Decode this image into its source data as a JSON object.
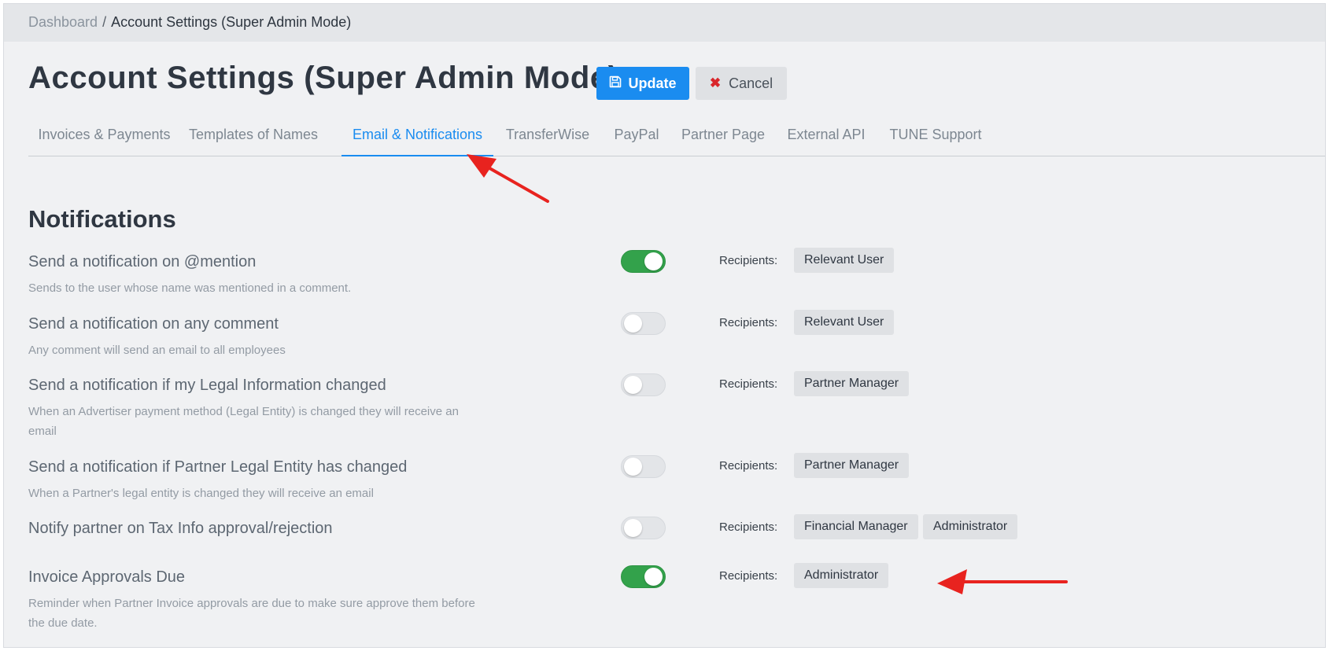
{
  "breadcrumb": {
    "home": "Dashboard",
    "separator": "/",
    "current": "Account Settings (Super Admin Mode)"
  },
  "header": {
    "title": "Account Settings (Super Admin Mode)",
    "update_label": "Update",
    "cancel_label": "Cancel"
  },
  "tabs": [
    {
      "label": "Invoices & Payments",
      "active": false
    },
    {
      "label": "Templates of Names",
      "active": false
    },
    {
      "label": "Email & Notifications",
      "active": true
    },
    {
      "label": "TransferWise",
      "active": false
    },
    {
      "label": "PayPal",
      "active": false
    },
    {
      "label": "Partner Page",
      "active": false
    },
    {
      "label": "External API",
      "active": false
    },
    {
      "label": "TUNE Support",
      "active": false
    }
  ],
  "section": {
    "title": "Notifications",
    "recipients_label": "Recipients:"
  },
  "notifications": [
    {
      "title": "Send a notification on @mention",
      "description": "Sends to the user whose name was mentioned in a comment.",
      "enabled": true,
      "recipients": [
        "Relevant User"
      ]
    },
    {
      "title": "Send a notification on any comment",
      "description": "Any comment will send an email to all employees",
      "enabled": false,
      "recipients": [
        "Relevant User"
      ]
    },
    {
      "title": "Send a notification if my Legal Information changed",
      "description": "When an Advertiser payment method (Legal Entity) is changed they will receive an email",
      "enabled": false,
      "recipients": [
        "Partner Manager"
      ]
    },
    {
      "title": "Send a notification if Partner Legal Entity has changed",
      "description": "When a Partner's legal entity is changed they will receive an email",
      "enabled": false,
      "recipients": [
        "Partner Manager"
      ]
    },
    {
      "title": "Notify partner on Tax Info approval/rejection",
      "description": "",
      "enabled": false,
      "recipients": [
        "Financial Manager",
        "Administrator"
      ]
    },
    {
      "title": "Invoice Approvals Due",
      "description": "Reminder when Partner Invoice approvals are due to make sure approve them before the due date.",
      "enabled": true,
      "recipients": [
        "Administrator"
      ]
    }
  ],
  "colors": {
    "accent": "#1a8cf0",
    "toggle_on": "#33a24b",
    "annotation_arrow": "#e8231f"
  },
  "icons": {
    "update": "floppy-disk-icon",
    "cancel": "x-mark-icon"
  }
}
